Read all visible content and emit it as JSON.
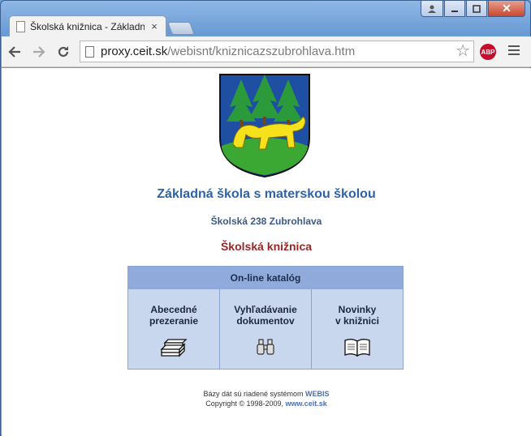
{
  "browser": {
    "tab_title": "Školská knižnica - Základn",
    "tab_close": "×",
    "url_host": "proxy.ceit.sk",
    "url_path": "/webisnt/kniznicazszubrohlava.htm",
    "abp_label": "ABP",
    "controls": {
      "close": "✕"
    }
  },
  "page": {
    "school_name": "Základná škola s materskou školou",
    "address": "Školská 238 Zubrohlava",
    "library": "Školská knižnica",
    "catalog": {
      "header": "On-line katalóg",
      "cells": [
        {
          "label": "Abecedné\nprezeranie",
          "icon": "books-stack-icon"
        },
        {
          "label": "Vyhľadávanie\ndokumentov",
          "icon": "binoculars-icon"
        },
        {
          "label": "Novinky\nv knižnici",
          "icon": "open-book-icon"
        }
      ]
    },
    "footer": {
      "line1_prefix": "Bázy dát sú riadené systémom",
      "line1_link": "WEBIS",
      "line2_prefix": "Copyright © 1998-2009,",
      "line2_link": "www.ceit.sk"
    }
  },
  "colors": {
    "school_name": "#2f63a8",
    "library": "#9a2525",
    "catalog_header": "#8faadb",
    "catalog_cell": "#c8d7ee"
  }
}
